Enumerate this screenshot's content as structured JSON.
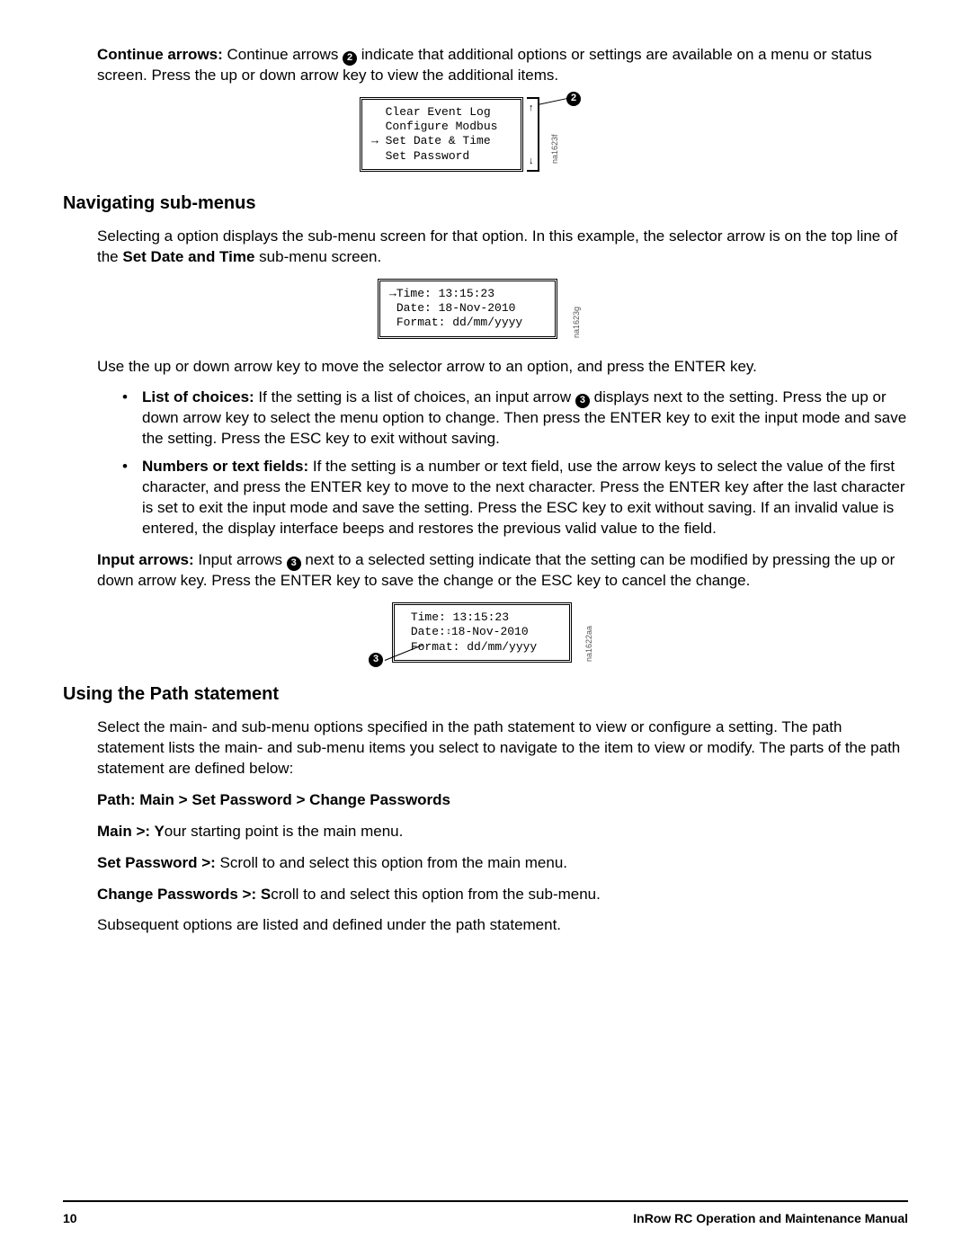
{
  "sections": {
    "continue": {
      "heading_prefix": "Continue arrows:",
      "callout_num": "2",
      "text_before": " Continue arrows ",
      "text_after": " indicate that additional options or settings are available on a menu or status screen. Press the up or down arrow key to view the additional items.",
      "lcd": {
        "line1": "Clear Event Log",
        "line2": "Configure Modbus",
        "line3_with_arrow": "Set Date & Time",
        "line4": "Set Password"
      },
      "fig_id": "na1623f"
    },
    "nav_submenus": {
      "heading": "Navigating sub-menus",
      "intro_before_bold": "Selecting a option displays the sub-menu screen for that option. In this example, the selector arrow is on the top line of the ",
      "bold_span": "Set Date and Time",
      "intro_after_bold": " sub-menu screen.",
      "lcd": {
        "line1_prefix": "Time:",
        "line1_value": " 13:15:23",
        "line2": "Date: 18-Nov-2010",
        "line3": "Format: dd/mm/yyyy"
      },
      "fig_id": "na1623g",
      "after_fig": "Use the up or down arrow key to move the selector arrow to an option, and press the ENTER key.",
      "bullet1_prefix": "List of choices:",
      "bullet1_before": " If the setting is a list of choices, an input arrow ",
      "bullet1_callout": "3",
      "bullet1_after": " displays next to the setting. Press the up or down arrow key to select the menu option to change. Then press the ENTER key to exit the input mode and save the setting. Press the ESC key to exit without saving.",
      "bullet2_prefix": "Numbers or text fields:",
      "bullet2_text": " If the setting is a number or text field, use the arrow keys to select the value of the first character, and press the ENTER key to move to the next character. Press the ENTER key after the last character is set to exit the input mode and save the setting. Press the ESC key to exit without saving. If an invalid value is entered, the display interface beeps and restores the previous valid value to the field."
    },
    "input_arrows": {
      "heading_prefix": "Input arrows:",
      "text_before": " Input arrows ",
      "callout_num": "3",
      "text_after": " next to a selected setting indicate that the setting can be modified by pressing the up or down arrow key. Press the ENTER key to save the change or the ESC key to cancel the change.",
      "lcd": {
        "line1": "Time: 13:15:23",
        "line2_before": "Date:",
        "line2_after": "18-Nov-2010",
        "line3": "Format: dd/mm/yyyy"
      },
      "fig_id": "na1622aa"
    },
    "path": {
      "heading": "Using the Path statement",
      "intro": "Select the main- and sub-menu options specified in the path statement to view or configure a setting. The path statement lists the main- and sub-menu items you select to navigate to the item to view or modify. The parts of the path statement are defined below:",
      "path_line": "Path: Main > Set Password > Change Passwords",
      "main_label": "Main >: ",
      "main_text_firstchar": "Y",
      "main_text_rest": "our starting point is the main menu.",
      "setpw_label": "Set Password >:",
      "setpw_text": " Scroll to and select this option from the main menu.",
      "chpw_label": "Change Passwords >: ",
      "chpw_text_firstchar": "S",
      "chpw_text_rest": "croll to and select this option from the sub-menu.",
      "trailer": "Subsequent options are listed and defined under the path statement."
    }
  },
  "footer": {
    "page": "10",
    "title": "InRow RC Operation and Maintenance Manual"
  }
}
